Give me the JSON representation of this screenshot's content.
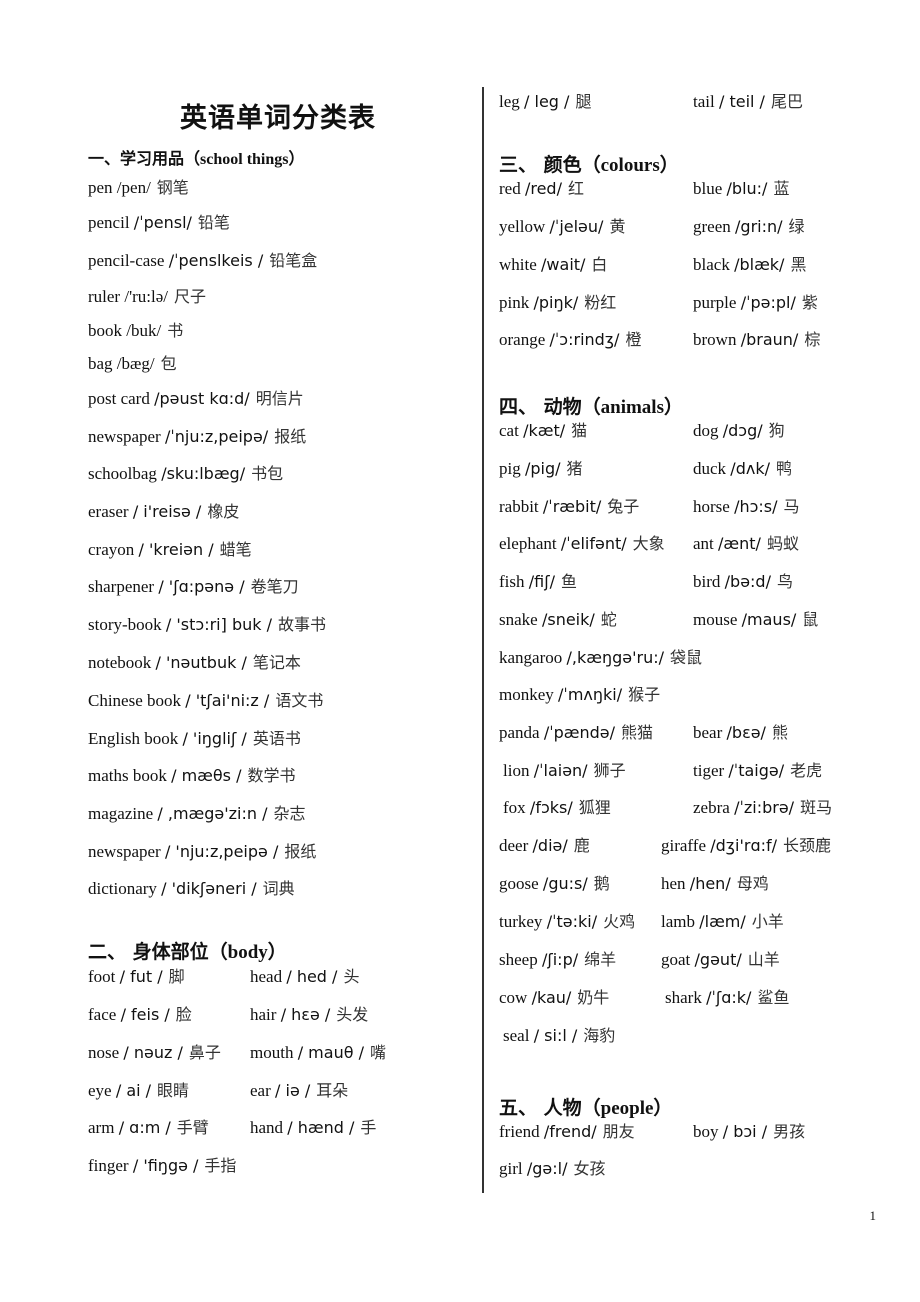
{
  "title": "英语单词分类表",
  "page_number": "1",
  "sections": {
    "school": {
      "heading_zh": "一、学习用品（",
      "heading_en": "school things",
      "heading_close": "）",
      "items": [
        {
          "word": "pen",
          "ipa": "/pen/",
          "zh": "钢笔"
        },
        {
          "word": "pencil",
          "ipa": "/ˈpensl/",
          "zh": "铅笔"
        },
        {
          "word": "pencil-case",
          "ipa": "/ˈpenslkeis /",
          "zh": "铅笔盒"
        },
        {
          "word": "ruler",
          "ipa": "/'ru:lə/",
          "zh": "尺子"
        },
        {
          "word": "book",
          "ipa": "/buk/",
          "zh": "书"
        },
        {
          "word": "bag",
          "ipa": "/bæg/",
          "zh": "包"
        },
        {
          "word": "post card",
          "ipa": "/pəust kɑ:d/",
          "zh": "明信片"
        },
        {
          "word": "newspaper",
          "ipa": "/ˈnju:z,peipə/",
          "zh": "报纸"
        },
        {
          "word": "schoolbag",
          "ipa": "/sku:lbæg/",
          "zh": "书包"
        },
        {
          "word": "eraser",
          "ipa": "/ i'reisə /",
          "zh": "橡皮"
        },
        {
          "word": "crayon",
          "ipa": "/ 'kreiən /",
          "zh": "蜡笔"
        },
        {
          "word": "sharpener",
          "ipa": "/ 'ʃɑ:pənə /",
          "zh": "卷笔刀"
        },
        {
          "word": "story-book",
          "ipa": "/ 'stɔ:ri] buk /",
          "zh": "故事书"
        },
        {
          "word": "notebook",
          "ipa": "/ 'nəutbuk /",
          "zh": "笔记本"
        },
        {
          "word": "Chinese book",
          "ipa": "/ 'tʃai'ni:z /",
          "zh": "语文书"
        },
        {
          "word": "English book",
          "ipa": "/ 'iŋgliʃ /",
          "zh": "英语书"
        },
        {
          "word": "maths book",
          "ipa": "/ mæθs /",
          "zh": "数学书"
        },
        {
          "word": "magazine",
          "ipa": "/ ,mægə'zi:n /",
          "zh": "杂志"
        },
        {
          "word": "newspaper",
          "ipa": "/ 'nju:z,peipə /",
          "zh": "报纸"
        },
        {
          "word": "dictionary",
          "ipa": "/ 'dikʃəneri /",
          "zh": "词典"
        }
      ]
    },
    "body": {
      "heading_zh": "二、 身体部位（",
      "heading_en": "body",
      "heading_close": "）",
      "rows": [
        [
          {
            "word": "foot",
            "ipa": "/ fut /",
            "zh": "脚"
          },
          {
            "word": "head",
            "ipa": "/ hed /",
            "zh": "头"
          }
        ],
        [
          {
            "word": "face",
            "ipa": "/ feis /",
            "zh": "脸"
          },
          {
            "word": "hair",
            "ipa": "/ hɛə /",
            "zh": "头发"
          }
        ],
        [
          {
            "word": "nose",
            "ipa": "/ nəuz /",
            "zh": "鼻子"
          },
          {
            "word": "mouth",
            "ipa": "/ mauθ /",
            "zh": "嘴"
          }
        ],
        [
          {
            "word": "eye",
            "ipa": "/ ai /",
            "zh": "眼睛"
          },
          {
            "word": "ear",
            "ipa": "/ iə /",
            "zh": "耳朵"
          }
        ],
        [
          {
            "word": "arm",
            "ipa": "/ ɑ:m /",
            "zh": "手臂"
          },
          {
            "word": "hand",
            "ipa": "/ hænd /",
            "zh": "手"
          }
        ],
        [
          {
            "word": "finger",
            "ipa": "/ 'fiŋgə /",
            "zh": "手指"
          }
        ],
        [
          {
            "word": "leg",
            "ipa": "/ leg /",
            "zh": "腿"
          },
          {
            "word": "tail",
            "ipa": "/ teil /",
            "zh": "尾巴"
          }
        ]
      ]
    },
    "colours": {
      "heading_zh": "三、 颜色（",
      "heading_en": "colours",
      "heading_close": "）",
      "rows": [
        [
          {
            "word": "red",
            "ipa": "/red/",
            "zh": "红"
          },
          {
            "word": "blue",
            "ipa": "/blu:/",
            "zh": "蓝"
          }
        ],
        [
          {
            "word": "yellow",
            "ipa": "/ˈjeləu/",
            "zh": "黄"
          },
          {
            "word": "green",
            "ipa": "/gri:n/",
            "zh": "绿"
          }
        ],
        [
          {
            "word": "white",
            "ipa": "/wait/",
            "zh": "白"
          },
          {
            "word": "black",
            "ipa": "/blæk/",
            "zh": "黑"
          }
        ],
        [
          {
            "word": "pink",
            "ipa": "/piŋk/",
            "zh": "粉红"
          },
          {
            "word": "purple",
            "ipa": "/ˈpə:pl/",
            "zh": "紫"
          }
        ],
        [
          {
            "word": "orange",
            "ipa": "/ˈɔ:rindʒ/",
            "zh": "橙"
          },
          {
            "word": "brown",
            "ipa": "/braun/",
            "zh": "棕"
          }
        ]
      ]
    },
    "animals": {
      "heading_zh": "四、 动物（",
      "heading_en": "animals",
      "heading_close": "）",
      "rows": [
        [
          {
            "word": "cat",
            "ipa": "/kæt/",
            "zh": "猫"
          },
          {
            "word": "dog",
            "ipa": "/dɔg/",
            "zh": "狗"
          }
        ],
        [
          {
            "word": "pig",
            "ipa": "/pig/",
            "zh": "猪"
          },
          {
            "word": "duck",
            "ipa": "/dʌk/",
            "zh": "鸭"
          }
        ],
        [
          {
            "word": "rabbit",
            "ipa": "/ˈræbit/",
            "zh": "兔子"
          },
          {
            "word": "horse",
            "ipa": "/hɔ:s/",
            "zh": "马"
          }
        ],
        [
          {
            "word": "elephant",
            "ipa": "/ˈelifənt/",
            "zh": "大象"
          },
          {
            "word": "ant",
            "ipa": "/ænt/",
            "zh": "蚂蚁"
          }
        ],
        [
          {
            "word": "fish",
            "ipa": "/fiʃ/",
            "zh": "鱼"
          },
          {
            "word": "bird",
            "ipa": "/bə:d/",
            "zh": "鸟"
          }
        ],
        [
          {
            "word": "snake",
            "ipa": "/sneik/",
            "zh": "蛇"
          },
          {
            "word": "mouse",
            "ipa": "/maus/",
            "zh": "鼠"
          }
        ],
        [
          {
            "word": "kangaroo",
            "ipa": "/,kæŋgə'ru:/",
            "zh": "袋鼠"
          }
        ],
        [
          {
            "word": "monkey",
            "ipa": "/ˈmʌŋki/",
            "zh": "猴子"
          }
        ],
        [
          {
            "word": "panda",
            "ipa": "/ˈpændə/",
            "zh": "熊猫"
          },
          {
            "word": "bear",
            "ipa": "/bɛə/",
            "zh": "熊"
          }
        ],
        [
          {
            "word": "lion",
            "ipa": "/ˈlaiən/",
            "zh": "狮子"
          },
          {
            "word": "tiger",
            "ipa": "/ˈtaigə/",
            "zh": "老虎"
          }
        ],
        [
          {
            "word": "fox",
            "ipa": "/fɔks/",
            "zh": "狐狸"
          },
          {
            "word": "zebra",
            "ipa": "/ˈzi:brə/",
            "zh": "斑马"
          }
        ],
        [
          {
            "word": "deer",
            "ipa": "/diə/",
            "zh": "鹿"
          },
          {
            "word": "giraffe",
            "ipa": "/dʒi'rɑ:f/",
            "zh": "长颈鹿"
          }
        ],
        [
          {
            "word": "goose",
            "ipa": "/gu:s/",
            "zh": "鹅"
          },
          {
            "word": "hen",
            "ipa": "/hen/",
            "zh": "母鸡"
          }
        ],
        [
          {
            "word": "turkey",
            "ipa": "/ˈtə:ki/",
            "zh": "火鸡"
          },
          {
            "word": "lamb",
            "ipa": "/læm/",
            "zh": "小羊"
          }
        ],
        [
          {
            "word": "sheep",
            "ipa": "/ʃi:p/",
            "zh": "绵羊"
          },
          {
            "word": "goat",
            "ipa": "/gəut/",
            "zh": "山羊"
          }
        ],
        [
          {
            "word": "cow",
            "ipa": "/kau/",
            "zh": "奶牛"
          },
          {
            "word": "shark",
            "ipa": "/ˈʃɑ:k/",
            "zh": "鲨鱼"
          }
        ],
        [
          {
            "word": "seal",
            "ipa": "/ si:l /",
            "zh": "海豹"
          }
        ]
      ]
    },
    "people": {
      "heading_zh": "五、 人物（",
      "heading_en": "people",
      "heading_close": "）",
      "rows": [
        [
          {
            "word": "friend",
            "ipa": "/frend/",
            "zh": "朋友"
          },
          {
            "word": "boy",
            "ipa": "/ bɔi /",
            "zh": "男孩"
          }
        ],
        [
          {
            "word": "girl",
            "ipa": "/gə:l/",
            "zh": "女孩"
          }
        ]
      ]
    }
  }
}
